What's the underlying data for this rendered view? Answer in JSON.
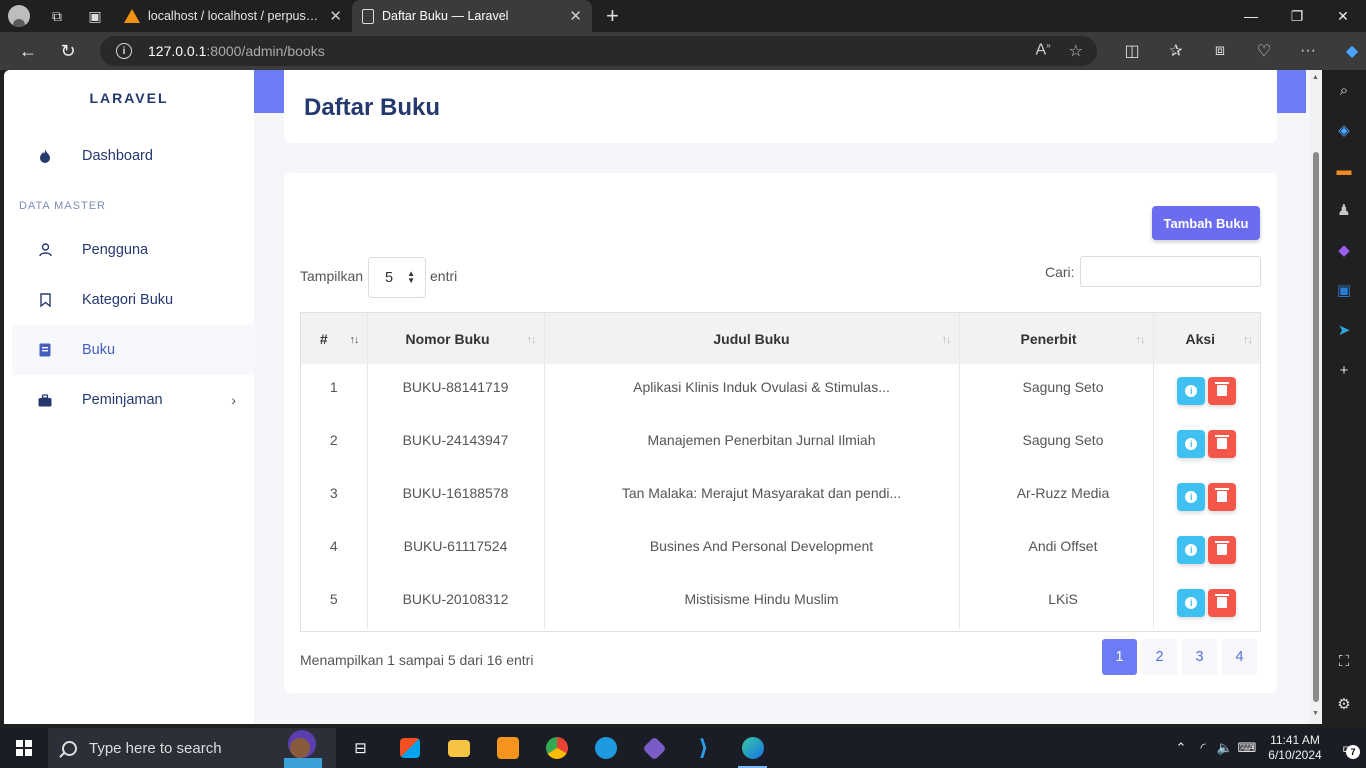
{
  "browser": {
    "tabs": [
      {
        "title": "localhost / localhost / perpus_we",
        "icon": "phpmyadmin-icon"
      },
      {
        "title": "Daftar Buku — Laravel",
        "icon": "document-icon"
      }
    ],
    "url_host": "127.0.0.1",
    "url_rest": ":8000/admin/books"
  },
  "app": {
    "brand": "LARAVEL",
    "accent_color": "#6c7cf4"
  },
  "sidebar": {
    "header_master": "DATA MASTER",
    "items": [
      {
        "label": "Dashboard",
        "icon": "fire-icon"
      },
      {
        "label": "Pengguna",
        "icon": "user-icon"
      },
      {
        "label": "Kategori Buku",
        "icon": "bookmark-icon"
      },
      {
        "label": "Buku",
        "icon": "book-icon",
        "active": true
      },
      {
        "label": "Peminjaman",
        "icon": "briefcase-icon"
      }
    ]
  },
  "page": {
    "title": "Daftar Buku",
    "add_button": "Tambah Buku",
    "length_label": "Tampilkan",
    "length_value": "5",
    "length_after": "entri",
    "search_label": "Cari:",
    "search_value": ""
  },
  "table": {
    "columns": [
      "#",
      "Nomor Buku",
      "Judul Buku",
      "Penerbit",
      "Aksi"
    ],
    "rows": [
      {
        "no": "1",
        "nomor": "BUKU-88141719",
        "judul": "Aplikasi Klinis Induk Ovulasi & Stimulas...",
        "penerbit": "Sagung Seto"
      },
      {
        "no": "2",
        "nomor": "BUKU-24143947",
        "judul": "Manajemen Penerbitan Jurnal Ilmiah",
        "penerbit": "Sagung Seto"
      },
      {
        "no": "3",
        "nomor": "BUKU-16188578",
        "judul": "Tan Malaka: Merajut Masyarakat dan pendi...",
        "penerbit": "Ar-Ruzz Media"
      },
      {
        "no": "4",
        "nomor": "BUKU-61117524",
        "judul": "Busines And Personal Development",
        "penerbit": "Andi Offset"
      },
      {
        "no": "5",
        "nomor": "BUKU-20108312",
        "judul": "Mistisisme Hindu Muslim",
        "penerbit": "LKiS"
      }
    ],
    "info": "Menampilkan 1 sampai 5 dari 16 entri",
    "pages": [
      "1",
      "2",
      "3",
      "4"
    ],
    "current_page": "1"
  },
  "taskbar": {
    "search_placeholder": "Type here to search",
    "time": "11:41 AM",
    "date": "6/10/2024",
    "notification_count": "7"
  }
}
